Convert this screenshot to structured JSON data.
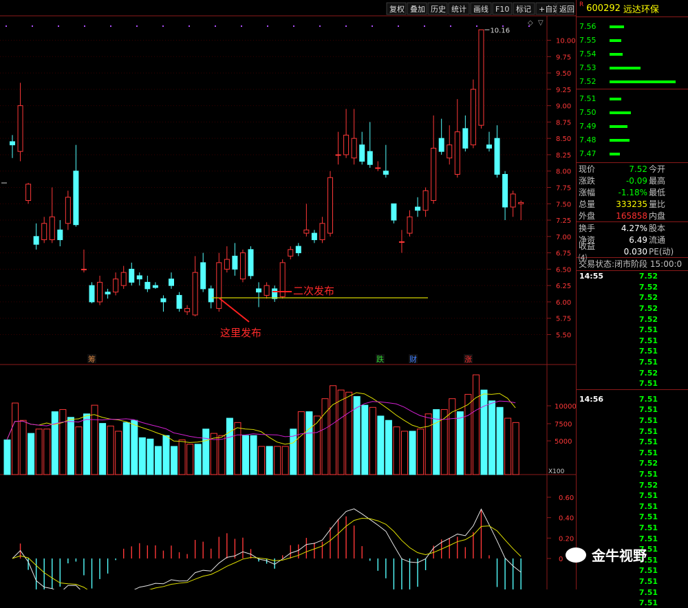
{
  "toolbar": {
    "buttons": [
      "复权",
      "叠加",
      "历史",
      "统计",
      "画线",
      "F10",
      "标记",
      "+自选",
      "返回"
    ]
  },
  "stock": {
    "marker": "R",
    "code": "600292",
    "name": "远达环保"
  },
  "orderbook": {
    "asks": [
      {
        "price": "7.56",
        "qty": 0.22
      },
      {
        "price": "7.55",
        "qty": 0.18
      },
      {
        "price": "7.54",
        "qty": 0.2
      },
      {
        "price": "7.53",
        "qty": 0.47
      },
      {
        "price": "7.52",
        "qty": 1.0
      }
    ],
    "bids": [
      {
        "price": "7.51",
        "qty": 0.18
      },
      {
        "price": "7.50",
        "qty": 0.32
      },
      {
        "price": "7.49",
        "qty": 0.27
      },
      {
        "price": "7.48",
        "qty": 0.3
      },
      {
        "price": "7.47",
        "qty": 0.16
      }
    ]
  },
  "quote": [
    {
      "k1": "现价",
      "v1": "7.52",
      "c1": "#00ff00",
      "k2": "今开"
    },
    {
      "k1": "涨跌",
      "v1": "-0.09",
      "c1": "#00ff00",
      "k2": "最高"
    },
    {
      "k1": "涨幅",
      "v1": "-1.18%",
      "c1": "#00ff00",
      "k2": "最低"
    },
    {
      "k1": "总量",
      "v1": "333235",
      "c1": "#ffff00",
      "k2": "量比"
    },
    {
      "k1": "外盘",
      "v1": "165858",
      "c1": "#ff3030",
      "k2": "内盘"
    }
  ],
  "quote2": [
    {
      "k1": "换手",
      "v1": "4.27%",
      "k2": "股本"
    },
    {
      "k1": "净资",
      "v1": "6.49",
      "k2": "流通"
    },
    {
      "k1": "收益⑷",
      "v1": "0.030",
      "k2": "PE(动)"
    }
  ],
  "status": {
    "label": "交易状态:",
    "value": "闭市阶段",
    "time": "15:00:0"
  },
  "ticks": {
    "g1_time": "14:55",
    "g1": [
      "7.52",
      "7.52",
      "7.52",
      "7.52",
      "7.52",
      "7.51",
      "7.51",
      "7.51",
      "7.51",
      "7.52",
      "7.51"
    ],
    "g2_time": "14:56",
    "g2": [
      "7.51",
      "7.51",
      "7.51",
      "7.51",
      "7.51",
      "7.51",
      "7.52",
      "7.51",
      "7.52",
      "7.51",
      "7.51",
      "7.51",
      "7.51",
      "7.51",
      "7.51",
      "7.51",
      "7.51",
      "7.51",
      "7.51",
      "7.51"
    ]
  },
  "watermark": "金牛视野",
  "chart_data": {
    "type": "candlestick",
    "price_axis": {
      "ticks": [
        "10.00",
        "9.75",
        "9.50",
        "9.25",
        "9.00",
        "8.75",
        "8.50",
        "8.25",
        "8.00",
        "7.75",
        "7.50",
        "7.25",
        "7.00",
        "6.75",
        "6.50",
        "6.25",
        "6.00",
        "5.75",
        "5.50"
      ],
      "range": [
        5.2,
        10.3
      ]
    },
    "high_label": "10.16",
    "candles": [
      {
        "o": 8.45,
        "c": 8.4,
        "h": 8.55,
        "l": 8.2
      },
      {
        "o": 8.3,
        "c": 9.0,
        "h": 9.35,
        "l": 8.15
      },
      {
        "o": 7.55,
        "c": 7.8,
        "h": 7.82,
        "l": 7.5
      },
      {
        "o": 7.0,
        "c": 6.88,
        "h": 7.2,
        "l": 6.8
      },
      {
        "o": 6.95,
        "c": 7.2,
        "h": 7.3,
        "l": 6.9
      },
      {
        "o": 6.95,
        "c": 7.3,
        "h": 7.75,
        "l": 6.9
      },
      {
        "o": 7.1,
        "c": 6.95,
        "h": 7.25,
        "l": 6.85
      },
      {
        "o": 7.2,
        "c": 7.6,
        "h": 7.7,
        "l": 7.1
      },
      {
        "o": 8.0,
        "c": 7.18,
        "h": 8.4,
        "l": 7.15
      },
      {
        "o": 6.5,
        "c": 6.5,
        "h": 6.8,
        "l": 6.45
      },
      {
        "o": 6.25,
        "c": 6.0,
        "h": 6.3,
        "l": 5.98
      },
      {
        "o": 6.0,
        "c": 6.3,
        "h": 6.4,
        "l": 5.95
      },
      {
        "o": 6.15,
        "c": 6.12,
        "h": 6.2,
        "l": 6.05
      },
      {
        "o": 6.15,
        "c": 6.35,
        "h": 6.45,
        "l": 6.1
      },
      {
        "o": 6.25,
        "c": 6.45,
        "h": 6.55,
        "l": 6.2
      },
      {
        "o": 6.5,
        "c": 6.3,
        "h": 6.6,
        "l": 6.25
      },
      {
        "o": 6.4,
        "c": 6.35,
        "h": 6.45,
        "l": 6.25
      },
      {
        "o": 6.3,
        "c": 6.2,
        "h": 6.4,
        "l": 6.15
      },
      {
        "o": 6.25,
        "c": 6.22,
        "h": 6.3,
        "l": 6.2
      },
      {
        "o": 6.05,
        "c": 6.0,
        "h": 6.1,
        "l": 5.85
      },
      {
        "o": 6.35,
        "c": 6.25,
        "h": 6.45,
        "l": 6.2
      },
      {
        "o": 6.1,
        "c": 5.9,
        "h": 6.15,
        "l": 5.85
      },
      {
        "o": 5.85,
        "c": 5.9,
        "h": 5.95,
        "l": 5.8
      },
      {
        "o": 5.8,
        "c": 6.45,
        "h": 6.7,
        "l": 5.78
      },
      {
        "o": 6.6,
        "c": 6.2,
        "h": 6.75,
        "l": 6.15
      },
      {
        "o": 6.2,
        "c": 6.0,
        "h": 6.25,
        "l": 5.9
      },
      {
        "o": 5.9,
        "c": 6.6,
        "h": 6.75,
        "l": 5.85
      },
      {
        "o": 6.5,
        "c": 6.65,
        "h": 6.85,
        "l": 6.45
      },
      {
        "o": 6.7,
        "c": 6.5,
        "h": 6.9,
        "l": 6.4
      },
      {
        "o": 6.35,
        "c": 6.75,
        "h": 6.8,
        "l": 6.3
      },
      {
        "o": 6.8,
        "c": 6.4,
        "h": 6.85,
        "l": 6.35
      },
      {
        "o": 6.2,
        "c": 6.15,
        "h": 6.3,
        "l": 5.92
      },
      {
        "o": 6.1,
        "c": 6.25,
        "h": 6.3,
        "l": 6.05
      },
      {
        "o": 6.2,
        "c": 6.05,
        "h": 6.25,
        "l": 6.0
      },
      {
        "o": 6.08,
        "c": 6.6,
        "h": 6.65,
        "l": 6.05
      },
      {
        "o": 6.7,
        "c": 6.8,
        "h": 6.85,
        "l": 6.65
      },
      {
        "o": 6.85,
        "c": 6.75,
        "h": 6.9,
        "l": 6.7
      },
      {
        "o": 7.05,
        "c": 7.1,
        "h": 7.5,
        "l": 7.0
      },
      {
        "o": 7.05,
        "c": 6.95,
        "h": 7.1,
        "l": 6.9
      },
      {
        "o": 6.95,
        "c": 7.2,
        "h": 7.3,
        "l": 6.9
      },
      {
        "o": 7.05,
        "c": 7.9,
        "h": 8.0,
        "l": 7.0
      },
      {
        "o": 8.25,
        "c": 8.25,
        "h": 8.6,
        "l": 8.1
      },
      {
        "o": 8.25,
        "c": 8.55,
        "h": 8.95,
        "l": 8.2
      },
      {
        "o": 8.2,
        "c": 8.5,
        "h": 8.95,
        "l": 8.1
      },
      {
        "o": 8.4,
        "c": 8.15,
        "h": 8.6,
        "l": 8.1
      },
      {
        "o": 8.3,
        "c": 8.1,
        "h": 8.75,
        "l": 8.05
      },
      {
        "o": 8.05,
        "c": 8.05,
        "h": 8.15,
        "l": 8.0
      },
      {
        "o": 8.0,
        "c": 7.95,
        "h": 8.4,
        "l": 7.9
      },
      {
        "o": 7.5,
        "c": 7.25,
        "h": 7.5,
        "l": 7.2
      },
      {
        "o": 6.92,
        "c": 6.92,
        "h": 7.1,
        "l": 6.75
      },
      {
        "o": 7.05,
        "c": 7.3,
        "h": 7.4,
        "l": 7.0
      },
      {
        "o": 7.45,
        "c": 7.4,
        "h": 7.6,
        "l": 7.3
      },
      {
        "o": 7.4,
        "c": 7.7,
        "h": 7.75,
        "l": 7.3
      },
      {
        "o": 7.55,
        "c": 8.35,
        "h": 8.85,
        "l": 7.5
      },
      {
        "o": 8.5,
        "c": 8.3,
        "h": 8.8,
        "l": 8.25
      },
      {
        "o": 8.2,
        "c": 8.4,
        "h": 8.7,
        "l": 8.1
      },
      {
        "o": 7.95,
        "c": 8.6,
        "h": 9.1,
        "l": 7.9
      },
      {
        "o": 8.65,
        "c": 8.35,
        "h": 8.85,
        "l": 8.3
      },
      {
        "o": 8.4,
        "c": 9.25,
        "h": 9.4,
        "l": 8.35
      },
      {
        "o": 8.7,
        "c": 10.16,
        "h": 10.16,
        "l": 8.65
      },
      {
        "o": 8.4,
        "c": 8.35,
        "h": 8.6,
        "l": 8.3
      },
      {
        "o": 8.5,
        "c": 7.95,
        "h": 8.7,
        "l": 7.9
      },
      {
        "o": 7.95,
        "c": 7.45,
        "h": 8.0,
        "l": 7.25
      },
      {
        "o": 7.45,
        "c": 7.65,
        "h": 7.7,
        "l": 7.3
      },
      {
        "o": 7.5,
        "c": 7.52,
        "h": 7.55,
        "l": 7.25
      }
    ],
    "annotations": [
      "二次发布",
      "这里发布"
    ],
    "event_labels": [
      "筹",
      "跌",
      "财",
      "涨"
    ],
    "volume_axis": {
      "ticks": [
        "10000",
        "7500",
        "5000"
      ],
      "unit": "X100"
    },
    "volumes": [
      800,
      1650,
      1250,
      950,
      1050,
      1050,
      1450,
      1500,
      1320,
      1100,
      1400,
      1600,
      1180,
      1120,
      1000,
      1200,
      1250,
      850,
      820,
      650,
      900,
      650,
      800,
      700,
      700,
      1050,
      950,
      900,
      1300,
      1200,
      900,
      900,
      650,
      650,
      650,
      650,
      1050,
      1450,
      1450,
      1350,
      1750,
      2050,
      1950,
      1900,
      1800,
      1600,
      1550,
      1350,
      1250,
      1100,
      1000,
      1000,
      1050,
      1400,
      1500,
      1500,
      1750,
      1450,
      1850,
      2300,
      1950,
      1700,
      1550,
      1300,
      1200
    ],
    "macd_axis": {
      "ticks": [
        "0.60",
        "0.40",
        "0.20",
        "0"
      ]
    }
  }
}
